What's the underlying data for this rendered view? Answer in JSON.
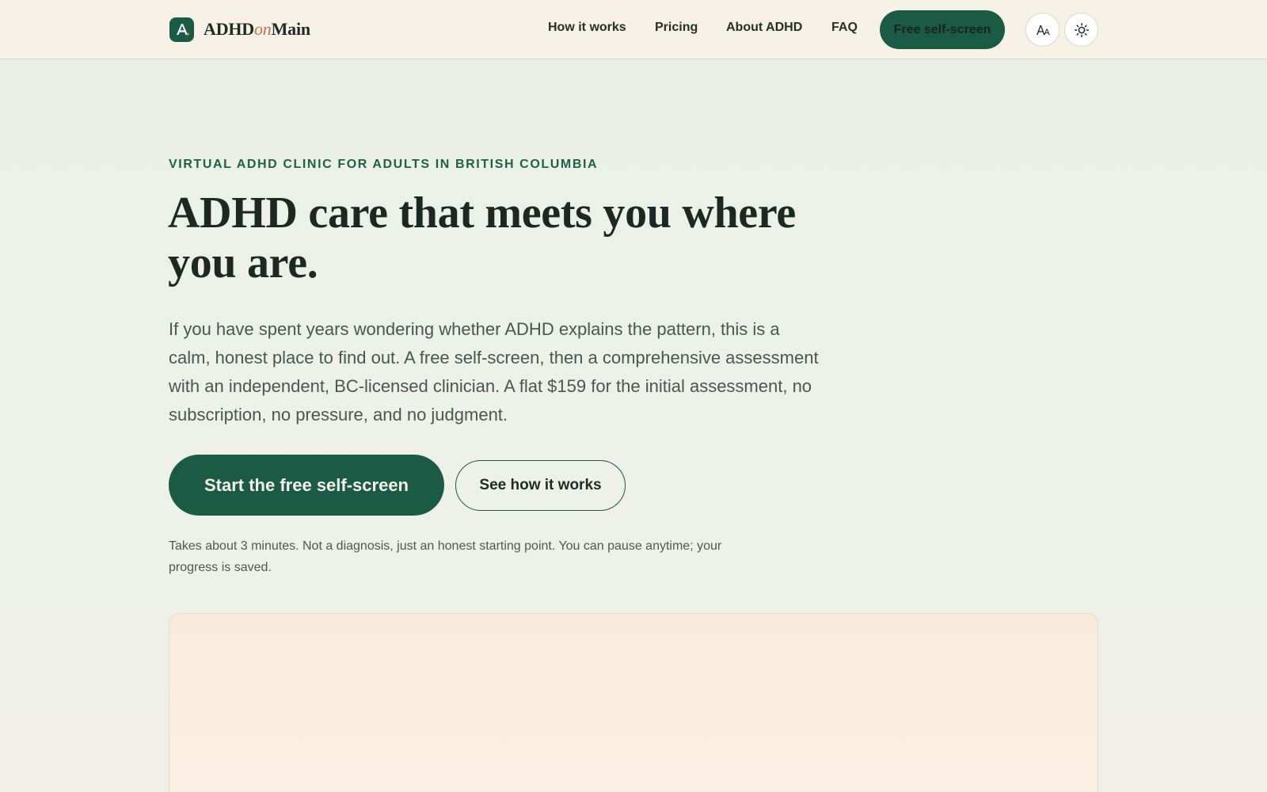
{
  "brand": {
    "name_part1": "ADHD",
    "name_part2": "on",
    "name_part3": "Main",
    "logo_icon": "letter-a-logo",
    "accent_color": "#1b5a45",
    "secondary_accent": "#b7784a"
  },
  "nav": {
    "items": [
      {
        "label": "How it works"
      },
      {
        "label": "Pricing"
      },
      {
        "label": "About ADHD"
      },
      {
        "label": "FAQ"
      }
    ],
    "cta_label": "Free self-screen",
    "icons": [
      "text-size-icon",
      "sun-icon"
    ]
  },
  "hero": {
    "eyebrow": "VIRTUAL ADHD CLINIC FOR ADULTS IN BRITISH COLUMBIA",
    "title": "ADHD care that meets you where you are.",
    "body": "If you have spent years wondering whether ADHD explains the pattern, this is a calm, honest place to find out. A free self-screen, then a comprehensive assessment with an independent, BC-licensed clinician. A flat $159 for the initial assessment, no subscription, no pressure, and no judgment.",
    "primary_cta": "Start the free self-screen",
    "secondary_cta": "See how it works",
    "fine_print": "Takes about 3 minutes. Not a diagnosis, just an honest starting point. You can pause anytime; your progress is saved."
  }
}
